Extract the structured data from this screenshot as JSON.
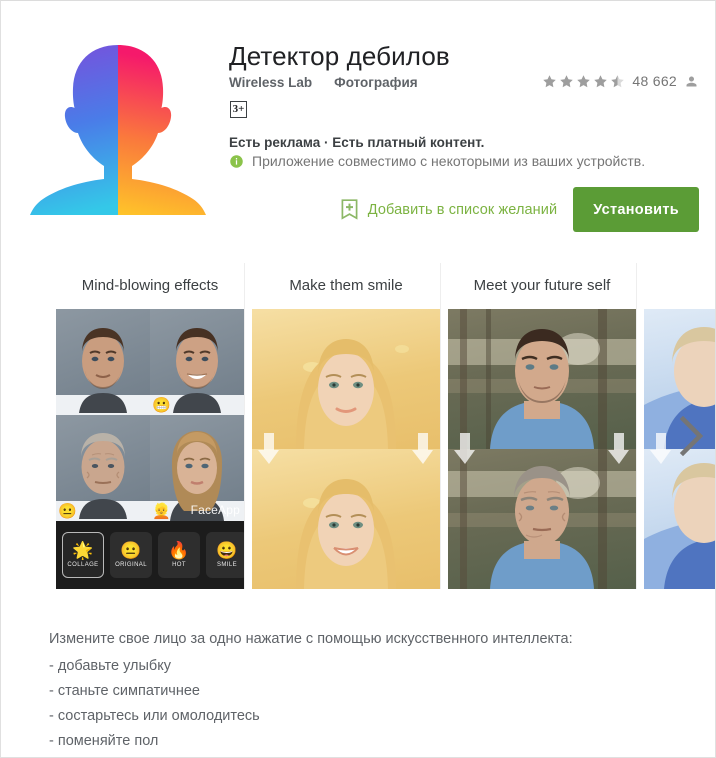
{
  "app": {
    "title": "Детектор дебилов",
    "developer": "Wireless Lab",
    "category": "Фотография",
    "age_rating": "3+",
    "ads_notice": "Есть реклама · Есть платный контент.",
    "compatibility_notice": "Приложение совместимо с некоторыми из ваших устройств.",
    "icon_name": "faceapp-head-icon",
    "icon_gradient_left": [
      "#7b4ddb",
      "#4a7ce8",
      "#34c8e8"
    ],
    "icon_gradient_right": [
      "#f5196b",
      "#fa7a3c",
      "#ffd226"
    ]
  },
  "rating": {
    "stars_filled": 4,
    "stars_half": 1,
    "stars_total": 5,
    "review_count": "48 662",
    "reviewer_icon": "person-icon"
  },
  "actions": {
    "wishlist_label": "Добавить в список желаний",
    "wishlist_icon": "bookmark-add-icon",
    "install_label": "Установить",
    "install_color": "#5b9c36",
    "wishlist_color": "#7cb342"
  },
  "carousel": {
    "next_icon": "chevron-right-icon",
    "screenshots": [
      {
        "caption": "Mind-blowing effects",
        "kind": "collage",
        "watermark": "FaceApp",
        "tiles": [
          {
            "name": "original-male",
            "emoji": "",
            "bg": "linear-gradient(160deg,#8d98a2 0%,#6f7c88 100%)",
            "skin": "#c99d7f",
            "hair": "#4a3425",
            "smile": false
          },
          {
            "name": "smiling-male",
            "emoji": "😬",
            "bg": "linear-gradient(160deg,#8d98a2 0%,#6f7c88 100%)",
            "skin": "#cda184",
            "hair": "#473123",
            "smile": true
          },
          {
            "name": "old-male",
            "emoji": "😐",
            "bg": "linear-gradient(160deg,#8d98a2 0%,#6f7c88 100%)",
            "skin": "#c9a68e",
            "hair": "#b9b2a8",
            "smile": false
          },
          {
            "name": "female-version",
            "emoji": "👱",
            "bg": "linear-gradient(160deg,#8d98a2 0%,#6f7c88 100%)",
            "skin": "#d9b396",
            "hair": "#b08a57",
            "smile": false
          }
        ],
        "filters": [
          {
            "label": "COLLAGE",
            "glyph": "🌟",
            "selected": true
          },
          {
            "label": "ORIGINAL",
            "glyph": "😐",
            "selected": false
          },
          {
            "label": "HOT",
            "glyph": "🔥",
            "selected": false
          },
          {
            "label": "SMILE",
            "glyph": "😀",
            "selected": false
          }
        ]
      },
      {
        "caption": "Make them smile",
        "kind": "pair",
        "top": {
          "name": "blonde-woman-neutral",
          "bg": "linear-gradient(170deg,#f6dfa4 0%,#ecc878 55%,#e8bf6b 100%)",
          "skin": "#f0d2b4",
          "hair": "#e8c073",
          "smile": false
        },
        "bottom": {
          "name": "blonde-woman-smiling",
          "bg": "linear-gradient(170deg,#f6dfa4 0%,#ecc878 55%,#e8bf6b 100%)",
          "skin": "#f0d2b4",
          "hair": "#e8c073",
          "smile": true
        }
      },
      {
        "caption": "Meet your future self",
        "kind": "pair",
        "top": {
          "name": "man-forest-young",
          "bg": "linear-gradient(170deg,#7d7a63 0%,#6a6b55 40%,#55604a 100%)",
          "skin": "#d2a98c",
          "hair": "#3b2a20",
          "shirt": "#6f9dc9",
          "smile": false
        },
        "bottom": {
          "name": "man-forest-old",
          "bg": "linear-gradient(170deg,#7d7a63 0%,#6a6b55 40%,#55604a 100%)",
          "skin": "#cfa88d",
          "hair": "#9a9288",
          "shirt": "#6f9dc9",
          "smile": false
        }
      },
      {
        "caption": "",
        "kind": "pair",
        "top": {
          "name": "snow-portrait-top",
          "bg": "linear-gradient(170deg,#dfeaf6 0%,#bfd4ec 60%,#9ab6de 100%)",
          "skin": "#ecd3bb",
          "hair": "#d9c79f",
          "shirt": "#4f74c0",
          "smile": false
        },
        "bottom": {
          "name": "snow-portrait-bottom",
          "bg": "linear-gradient(170deg,#dfeaf6 0%,#bfd4ec 60%,#9ab6de 100%)",
          "skin": "#ecd3bb",
          "hair": "#d9c79f",
          "shirt": "#4f74c0",
          "smile": false
        }
      }
    ]
  },
  "description": {
    "intro": "Измените свое лицо за одно нажатие с помощью искусственного интеллекта:",
    "bullets": [
      "- добавьте улыбку",
      "- станьте симпатичнее",
      "- состарьтесь или омолодитесь",
      "- поменяйте пол"
    ]
  }
}
